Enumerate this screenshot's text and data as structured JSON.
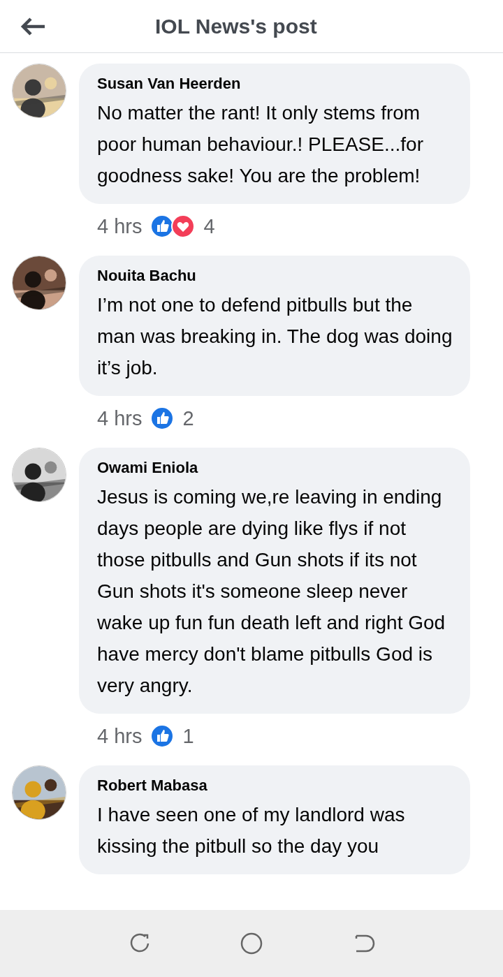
{
  "header": {
    "title": "IOL News's post"
  },
  "comments": [
    {
      "author": "Susan Van Heerden",
      "text": "No matter the rant! It only stems from poor human behaviour.! PLEASE...for goodness sake! You are the problem!",
      "time": "4 hrs",
      "reactions": [
        {
          "kind": "like"
        },
        {
          "kind": "love"
        }
      ],
      "count": "4"
    },
    {
      "author": "Nouita Bachu",
      "text": "I’m not one to defend pitbulls but the man was breaking in. The dog was doing it’s job.",
      "time": "4 hrs",
      "reactions": [
        {
          "kind": "like"
        }
      ],
      "count": "2"
    },
    {
      "author": "Owami Eniola",
      "text": "Jesus is coming we,re leaving in ending days people are dying like flys if not those pitbulls and Gun shots if its not Gun shots it's someone sleep never wake up fun fun death left and right God have mercy don't blame pitbulls God is very angry.",
      "time": "4 hrs",
      "reactions": [
        {
          "kind": "like"
        }
      ],
      "count": "1"
    },
    {
      "author": "Robert Mabasa",
      "text": "I have seen one of my landlord was kissing the pitbull so the day you"
    }
  ]
}
